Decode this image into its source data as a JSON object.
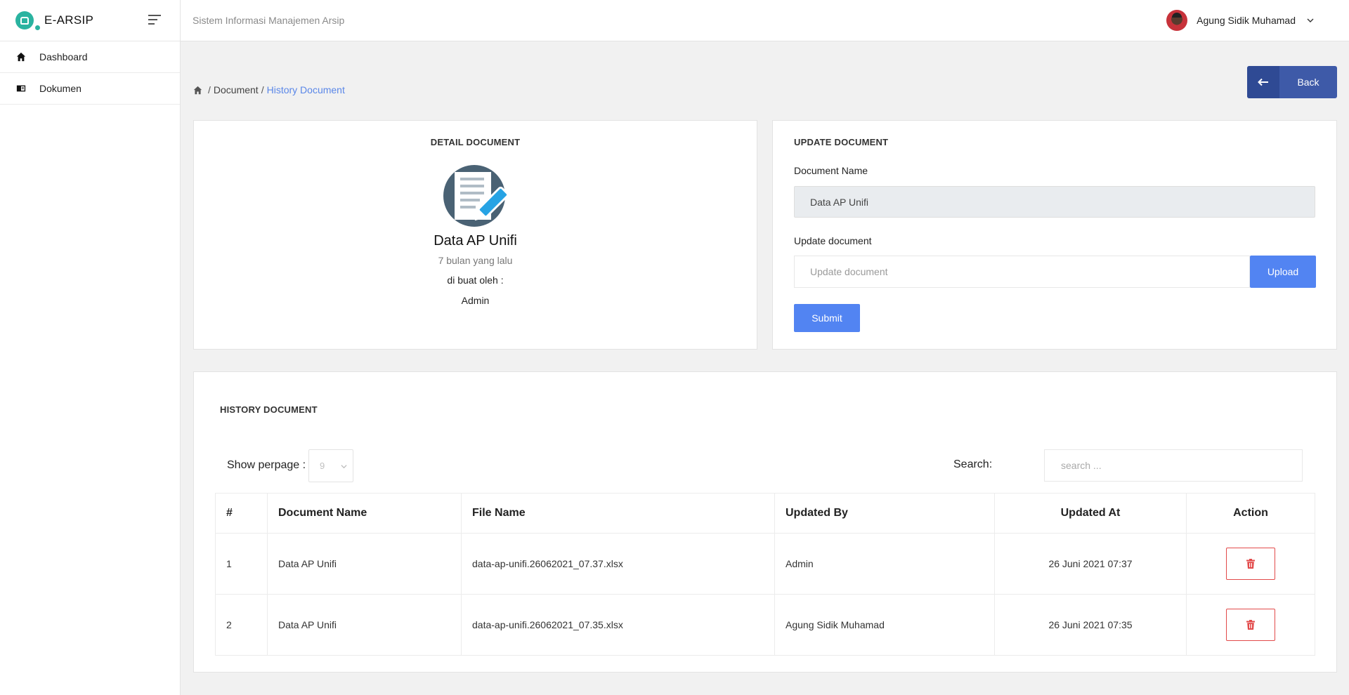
{
  "brand": {
    "name": "E-ARSIP"
  },
  "sidebar": {
    "items": [
      {
        "label": "Dashboard",
        "icon": "home-icon"
      },
      {
        "label": "Dokumen",
        "icon": "book-icon"
      }
    ]
  },
  "header": {
    "title": "Sistem Informasi Manajemen Arsip",
    "user_name": "Agung Sidik Muhamad"
  },
  "breadcrumb": {
    "items": [
      "Document",
      "History Document"
    ]
  },
  "back_button": {
    "label": "Back"
  },
  "detail": {
    "title": "DETAIL DOCUMENT",
    "doc_name": "Data AP Unifi",
    "time": "7 bulan yang lalu",
    "created_by_label": "di buat oleh :",
    "created_by": "Admin"
  },
  "update": {
    "title": "UPDATE DOCUMENT",
    "name_label": "Document Name",
    "name_value": "Data AP Unifi",
    "file_label": "Update document",
    "file_placeholder": "Update document",
    "upload_label": "Upload",
    "submit_label": "Submit"
  },
  "history": {
    "title": "HISTORY DOCUMENT",
    "perpage_label": "Show perpage :",
    "perpage_value": "9",
    "search_label": "Search:",
    "search_placeholder": "search ...",
    "columns": [
      "#",
      "Document Name",
      "File Name",
      "Updated By",
      "Updated At",
      "Action"
    ],
    "rows": [
      {
        "no": "1",
        "doc_name": "Data AP Unifi",
        "file_name": "data-ap-unifi.26062021_07.37.xlsx",
        "updated_by": "Admin",
        "updated_at": "26 Juni 2021 07:37"
      },
      {
        "no": "2",
        "doc_name": "Data AP Unifi",
        "file_name": "data-ap-unifi.26062021_07.35.xlsx",
        "updated_by": "Agung Sidik Muhamad",
        "updated_at": "26 Juni 2021 07:35"
      }
    ]
  },
  "colors": {
    "accent": "#5284f2",
    "back_button": "#3e5aa8",
    "brand": "#2ab3a0",
    "danger": "#e24a4a",
    "breadcrumb_active": "#5a87e8"
  }
}
